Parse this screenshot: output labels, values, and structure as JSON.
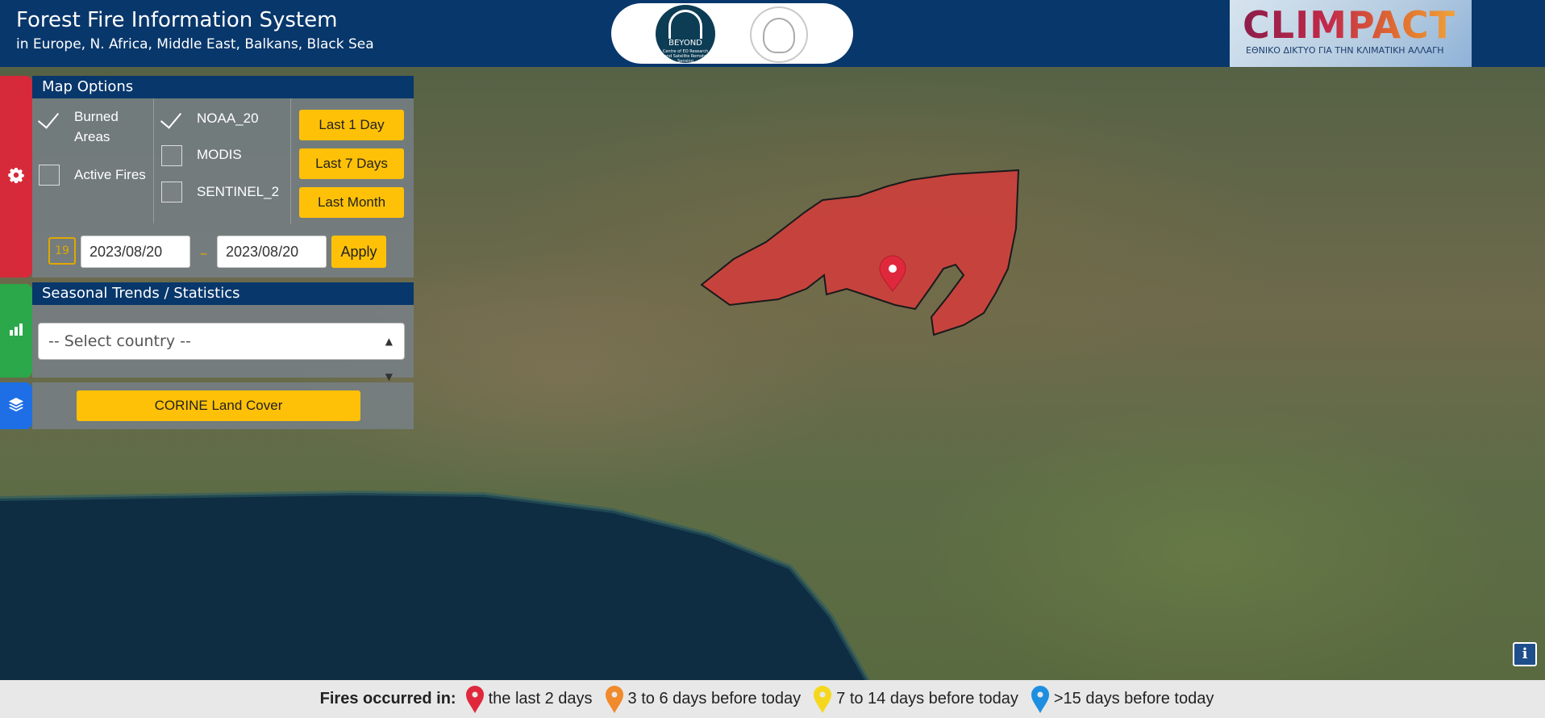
{
  "header": {
    "title": "Forest Fire Information System",
    "subtitle": "in Europe, N. Africa, Middle East, Balkans, Black Sea",
    "beyond_logo_text": "BEYOND",
    "beyond_logo_subtext": "Centre of EO Research and Satellite Remote Sensing",
    "climpact_logo": "CLIMPACT",
    "climpact_subtext": "ΕΘΝΙΚΟ ΔΙΚΤΥΟ ΓΙΑ ΤΗΝ ΚΛΙΜΑΤΙΚΗ ΑΛΛΑΓΗ"
  },
  "map_options": {
    "heading": "Map Options",
    "layers": [
      {
        "label": "Burned Areas",
        "checked": true
      },
      {
        "label": "Active Fires",
        "checked": false
      }
    ],
    "sensors": [
      {
        "label": "NOAA_20",
        "checked": true
      },
      {
        "label": "MODIS",
        "checked": false
      },
      {
        "label": "SENTINEL_2",
        "checked": false
      }
    ],
    "quick_ranges": [
      "Last 1 Day",
      "Last 7 Days",
      "Last Month"
    ],
    "calendar_icon_text": "19",
    "date_separator": "–",
    "date_from": "2023/08/20",
    "date_to": "2023/08/20",
    "apply_label": "Apply"
  },
  "trends": {
    "heading": "Seasonal Trends / Statistics",
    "country_select": "-- Select country --"
  },
  "land_cover": {
    "button_label": "CORINE Land Cover"
  },
  "legend": {
    "lead": "Fires occurred in:",
    "items": [
      {
        "label": "the last 2 days",
        "color": "#e0283c"
      },
      {
        "label": "3 to 6 days before today",
        "color": "#f08a2c"
      },
      {
        "label": "7 to 14 days before today",
        "color": "#f5d81e"
      },
      {
        "label": ">15 days before today",
        "color": "#1e8fe0"
      }
    ]
  },
  "icons": {
    "settings": "gear-icon",
    "stats": "bar-chart-icon",
    "layers": "layers-icon",
    "info": "info-icon",
    "calendar": "calendar-icon",
    "marker": "map-marker-icon"
  },
  "colors": {
    "header_bg": "#08376b",
    "accent_yellow": "#ffc107",
    "burned_area_fill": "#d93a3a",
    "tab_red": "#d62a3a",
    "tab_green": "#2aa84a",
    "tab_blue": "#1e6fe6"
  },
  "info_button_label": "i"
}
